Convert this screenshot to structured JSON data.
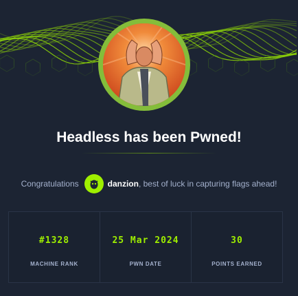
{
  "banner": {
    "accent": "#9fef00"
  },
  "machine": {
    "avatar_icon": "screaming-man-icon",
    "ring_color": "#84bd3a"
  },
  "title": "Headless has been Pwned!",
  "congrats": {
    "prefix": "Congratulations",
    "username": "danzion",
    "suffix": ", best of luck in capturing flags ahead!",
    "avatar_icon": "user-avatar-icon"
  },
  "stats": [
    {
      "value": "#1328",
      "label": "MACHINE RANK"
    },
    {
      "value": "25 Mar 2024",
      "label": "PWN DATE"
    },
    {
      "value": "30",
      "label": "POINTS EARNED"
    }
  ],
  "colors": {
    "background": "#1c2433",
    "accent": "#9fef00",
    "muted_text": "#a4b1cd"
  }
}
